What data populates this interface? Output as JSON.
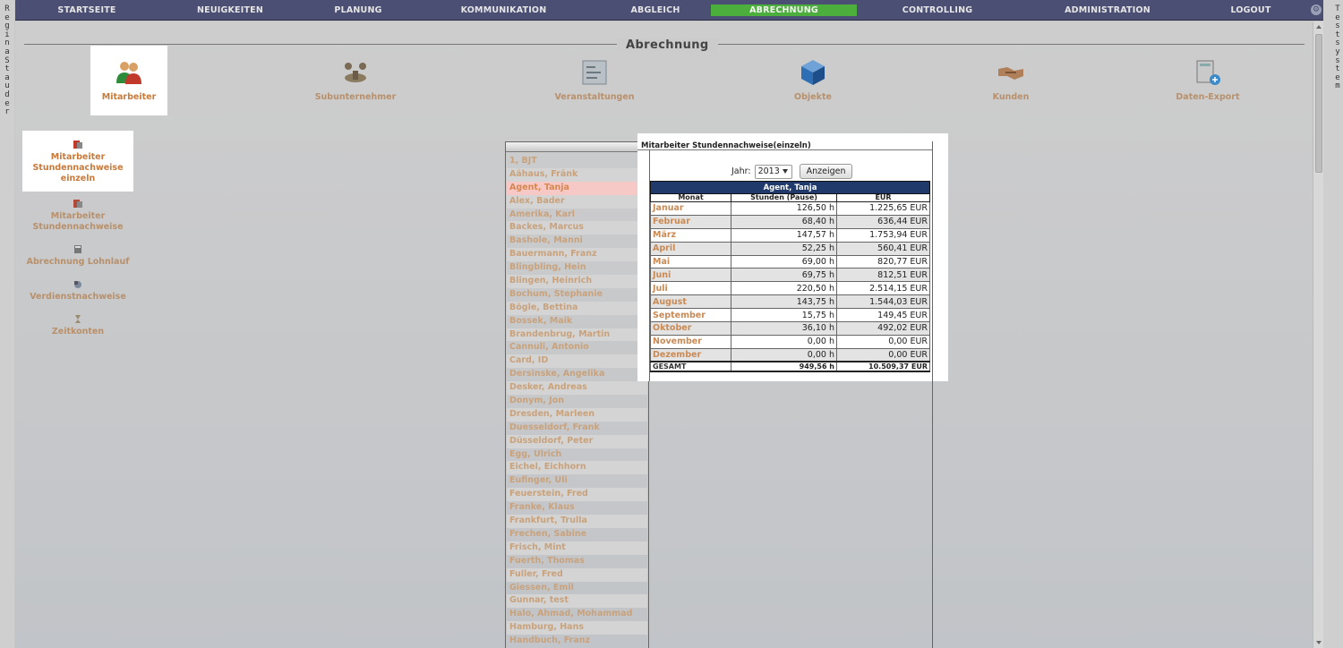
{
  "side": {
    "left_letters": [
      "R",
      "e",
      "g",
      "i",
      "n",
      "a",
      " ",
      "S",
      "t",
      "a",
      "u",
      "d",
      "e",
      "r"
    ],
    "right_letters": [
      "T",
      "e",
      "s",
      "t",
      "s",
      "y",
      "s",
      "t",
      "e",
      "m"
    ]
  },
  "nav": {
    "items": [
      "STARTSEITE",
      "NEUIGKEITEN",
      "PLANUNG",
      "KOMMUNIKATION",
      "ABGLEICH",
      "ABRECHNUNG",
      "CONTROLLING",
      "ADMINISTRATION",
      "LOGOUT"
    ],
    "active": "ABRECHNUNG"
  },
  "page": {
    "title": "Abrechnung"
  },
  "categories": [
    {
      "label": "Mitarbeiter",
      "icon": "users-icon",
      "active": true
    },
    {
      "label": "Subunternehmer",
      "icon": "subcontractor-icon",
      "active": false
    },
    {
      "label": "Veranstaltungen",
      "icon": "events-icon",
      "active": false
    },
    {
      "label": "Objekte",
      "icon": "cube-icon",
      "active": false
    },
    {
      "label": "Kunden",
      "icon": "handshake-icon",
      "active": false
    },
    {
      "label": "Daten-Export",
      "icon": "data-export-icon",
      "active": false
    }
  ],
  "submenu": [
    {
      "label_lines": [
        "Mitarbeiter",
        "Stundennachweise",
        "einzeln"
      ],
      "icon": "timesheet-icon",
      "active": true
    },
    {
      "label_lines": [
        "Mitarbeiter",
        "Stundennachweise"
      ],
      "icon": "timesheet-icon",
      "active": false
    },
    {
      "label_lines": [
        "Abrechnung Lohnlauf"
      ],
      "icon": "calculator-icon",
      "active": false
    },
    {
      "label_lines": [
        "Verdienstnachweise"
      ],
      "icon": "earnings-icon",
      "active": false
    },
    {
      "label_lines": [
        "Zeitkonten"
      ],
      "icon": "hourglass-icon",
      "active": false
    }
  ],
  "panel": {
    "title": "Mitarbeiter Stundennachweise(einzeln)"
  },
  "employees": [
    "1, BJT",
    "Aähaus, Fränk",
    "Agent, Tanja",
    "Alex, Bader",
    "Amerika, Karl",
    "Backes, Marcus",
    "Bashole, Manni",
    "Bauermann, Franz",
    "Blingbling, Hein",
    "Blingen, Heinrich",
    "Bochum, Stephanie",
    "Bögle, Bettina",
    "Bossek, Maik",
    "Brandenbrug, Martin",
    "Cannuli, Antonio",
    "Card, ID",
    "Dersinske, Angelika",
    "Desker, Andreas",
    "Donym, Jon",
    "Dresden, Marleen",
    "Duesseldorf, Frank",
    "Düsseldorf, Peter",
    "Egg, Ulrich",
    "Eichel, Eichhorn",
    "Eufinger, Uli",
    "Feuerstein, Fred",
    "Franke, Klaus",
    "Frankfurt, Trulla",
    "Frechen, Sabine",
    "Frisch, Mint",
    "Fuerth, Thomas",
    "Fuller, Fred",
    "Giessen, Emil",
    "Gunnar, test",
    "Halo, Ahmad, Mohammad",
    "Hamburg, Hans",
    "Handbuch, Franz"
  ],
  "selected_employee": "Agent, Tanja",
  "filter": {
    "year_label": "Jahr:",
    "year_value": "2013",
    "button_label": "Anzeigen"
  },
  "table": {
    "employee_name": "Agent, Tanja",
    "columns": [
      "Monat",
      "Stunden (Pause)",
      "EUR"
    ],
    "rows": [
      {
        "month": "Januar",
        "hours": "126,50 h",
        "eur": "1.225,65 EUR"
      },
      {
        "month": "Februar",
        "hours": "68,40 h",
        "eur": "636,44 EUR"
      },
      {
        "month": "März",
        "hours": "147,57 h",
        "eur": "1.753,94 EUR"
      },
      {
        "month": "April",
        "hours": "52,25 h",
        "eur": "560,41 EUR"
      },
      {
        "month": "Mai",
        "hours": "69,00 h",
        "eur": "820,77 EUR"
      },
      {
        "month": "Juni",
        "hours": "69,75 h",
        "eur": "812,51 EUR"
      },
      {
        "month": "Juli",
        "hours": "220,50 h",
        "eur": "2.514,15 EUR"
      },
      {
        "month": "August",
        "hours": "143,75 h",
        "eur": "1.544,03 EUR"
      },
      {
        "month": "September",
        "hours": "15,75 h",
        "eur": "149,45 EUR"
      },
      {
        "month": "Oktober",
        "hours": "36,10 h",
        "eur": "492,02 EUR"
      },
      {
        "month": "November",
        "hours": "0,00 h",
        "eur": "0,00 EUR"
      },
      {
        "month": "Dezember",
        "hours": "0,00 h",
        "eur": "0,00 EUR"
      }
    ],
    "total": {
      "label": "GESAMT",
      "hours": "949,56 h",
      "eur": "10.509,37 EUR"
    }
  },
  "colors": {
    "nav_bg": "#4b4f74",
    "nav_active": "#4cae3c",
    "link": "#c98a55",
    "table_head": "#1f3a6b",
    "selected_row": "#f7c9c6"
  }
}
